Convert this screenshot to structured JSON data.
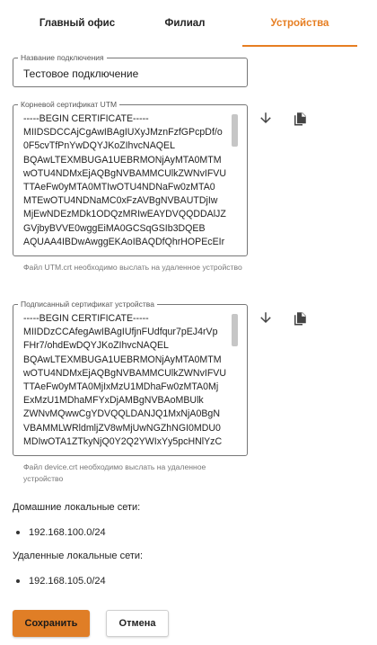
{
  "tabs": [
    {
      "label": "Главный офис"
    },
    {
      "label": "Филиал"
    },
    {
      "label": "Устройства",
      "active": true
    }
  ],
  "connection_name": {
    "label": "Название подключения",
    "value": "Тестовое подключение"
  },
  "utm_cert": {
    "label": "Корневой сертификат UTM",
    "value": "-----BEGIN CERTIFICATE-----\nMIIDSDCCAjCgAwIBAgIUXyJMznFzfGPcpDf/o\n0F5cvTfPnYwDQYJKoZIhvcNAQEL\nBQAwLTEXMBUGA1UEBRMONjAyMTA0MTM\nwOTU4NDMxEjAQBgNVBAMMCUlkZWNvIFVU\nTTAeFw0yMTA0MTIwOTU4NDNaFw0zMTA0\nMTEwOTU4NDNaMC0xFzAVBgNVBAUTDjIw\nMjEwNDEzMDk1ODQzMRIwEAYDVQQDDAlJZ\nGVjbyBVVE0wggEiMA0GCSqGSIb3DQEB\nAQUAA4IBDwAwggEKAoIBAQDfQhrHOPEcEIr",
    "helper": "Файл UTM.crt необходимо выслать на удаленное устройство"
  },
  "device_cert": {
    "label": "Подписанный сертификат устройства",
    "value": "-----BEGIN CERTIFICATE-----\nMIIDDzCCAfegAwIBAgIUfjnFUdfqur7pEJ4rVp\nFHr7/ohdEwDQYJKoZIhvcNAQEL\nBQAwLTEXMBUGA1UEBRMONjAyMTA0MTM\nwOTU4NDMxEjAQBgNVBAMMCUlkZWNvIFVU\nTTAeFw0yMTA0MjIxMzU1MDhaFw0zMTA0Mj\nExMzU1MDhaMFYxDjAMBgNVBAoMBUlk\nZWNvMQwwCgYDVQQLDANJQ1MxNjA0BgN\nVBAMMLWRldmljZV8wMjUwNGZhNGI0MDU0\nMDIwOTA1ZTkyNjQ0Y2Q2YWIxYy5pcHNlYzC",
    "helper": "Файл device.crt необходимо выслать на удаленное устройство"
  },
  "home_networks": {
    "title": "Домашние локальные сети:",
    "items": [
      "192.168.100.0/24"
    ]
  },
  "remote_networks": {
    "title": "Удаленные локальные сети:",
    "items": [
      "192.168.105.0/24"
    ]
  },
  "actions": {
    "save_label": "Сохранить",
    "cancel_label": "Отмена"
  },
  "colors": {
    "accent": "#e67e22",
    "save_button": "#e07e26"
  },
  "icons": [
    "download-icon",
    "copy-icon"
  ]
}
